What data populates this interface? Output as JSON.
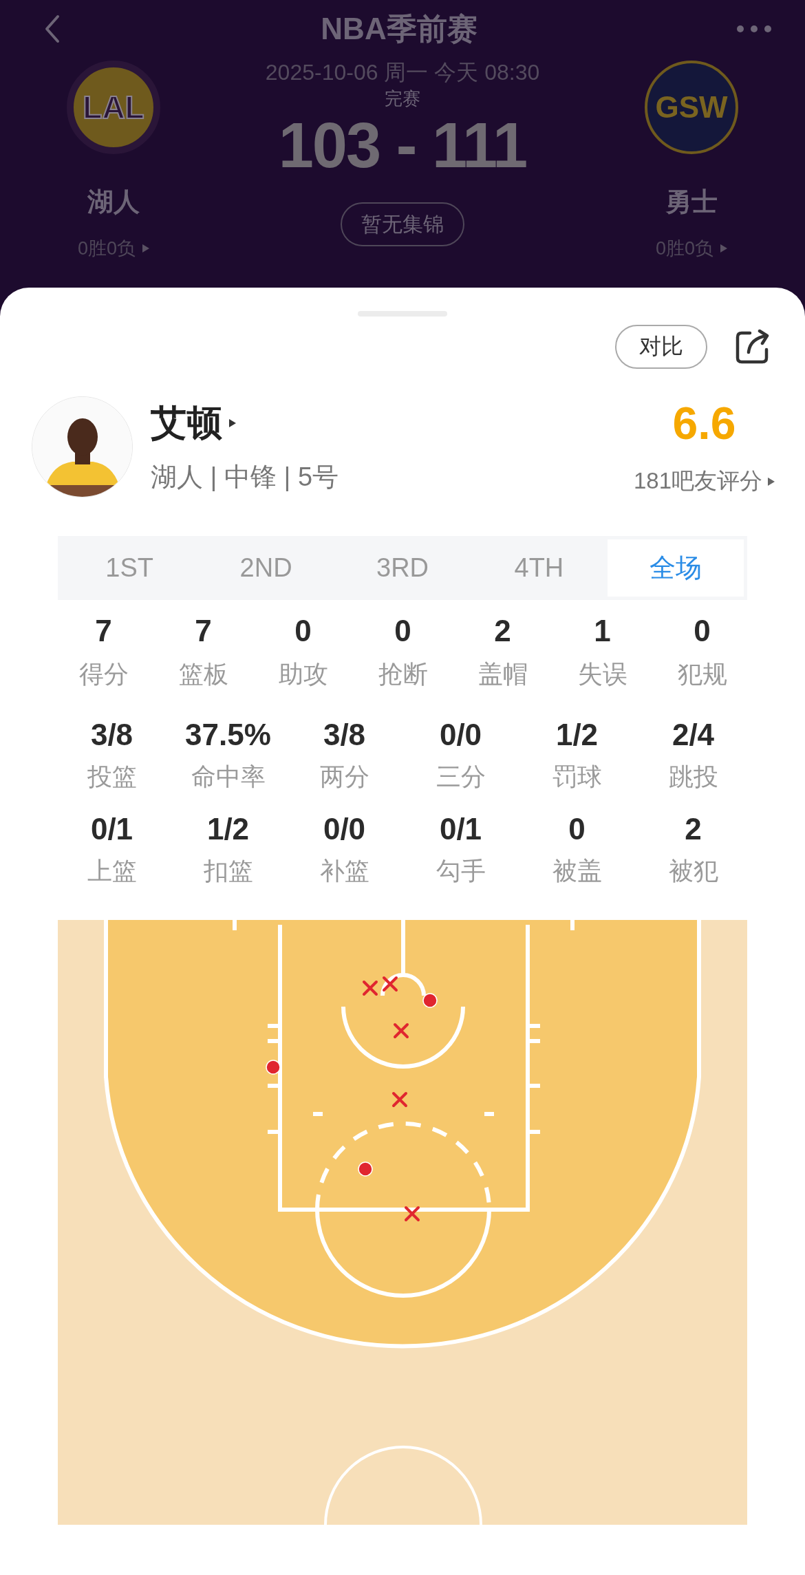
{
  "header": {
    "title": "NBA季前赛",
    "date": "2025-10-06 周一 今天 08:30",
    "status": "完赛",
    "score": "103 - 111",
    "highlights_button": "暂无集锦"
  },
  "teams": [
    {
      "logo_text": "LAL",
      "name": "湖人",
      "record": "0胜0负",
      "kind": "ring"
    },
    {
      "logo_text": "GSW",
      "name": "勇士",
      "record": "0胜0负",
      "kind": "badge"
    }
  ],
  "actions": {
    "compare_button": "对比"
  },
  "player": {
    "name": "艾顿",
    "info": "湖人 | 中锋 | 5号",
    "rating": "6.6",
    "rating_caption": "181吧友评分"
  },
  "periods": [
    {
      "label": "1ST",
      "selected": false
    },
    {
      "label": "2ND",
      "selected": false
    },
    {
      "label": "3RD",
      "selected": false
    },
    {
      "label": "4TH",
      "selected": false
    },
    {
      "label": "全场",
      "selected": true
    }
  ],
  "stats_basic": [
    {
      "value": "7",
      "label": "得分"
    },
    {
      "value": "7",
      "label": "篮板"
    },
    {
      "value": "0",
      "label": "助攻"
    },
    {
      "value": "0",
      "label": "抢断"
    },
    {
      "value": "2",
      "label": "盖帽"
    },
    {
      "value": "1",
      "label": "失误"
    },
    {
      "value": "0",
      "label": "犯规"
    }
  ],
  "stats_shooting": [
    [
      {
        "value": "3/8",
        "label": "投篮"
      },
      {
        "value": "37.5%",
        "label": "命中率"
      },
      {
        "value": "3/8",
        "label": "两分"
      },
      {
        "value": "0/0",
        "label": "三分"
      },
      {
        "value": "1/2",
        "label": "罚球"
      },
      {
        "value": "2/4",
        "label": "跳投"
      }
    ],
    [
      {
        "value": "0/1",
        "label": "上篮"
      },
      {
        "value": "1/2",
        "label": "扣篮"
      },
      {
        "value": "0/0",
        "label": "补篮"
      },
      {
        "value": "0/1",
        "label": "勾手"
      },
      {
        "value": "0",
        "label": "被盖"
      },
      {
        "value": "2",
        "label": "被犯"
      }
    ]
  ],
  "shot_chart": {
    "shots": [
      {
        "made": false
      },
      {
        "made": false
      },
      {
        "made": true
      },
      {
        "made": false
      },
      {
        "made": true
      },
      {
        "made": false
      },
      {
        "made": true
      },
      {
        "made": false
      }
    ]
  }
}
